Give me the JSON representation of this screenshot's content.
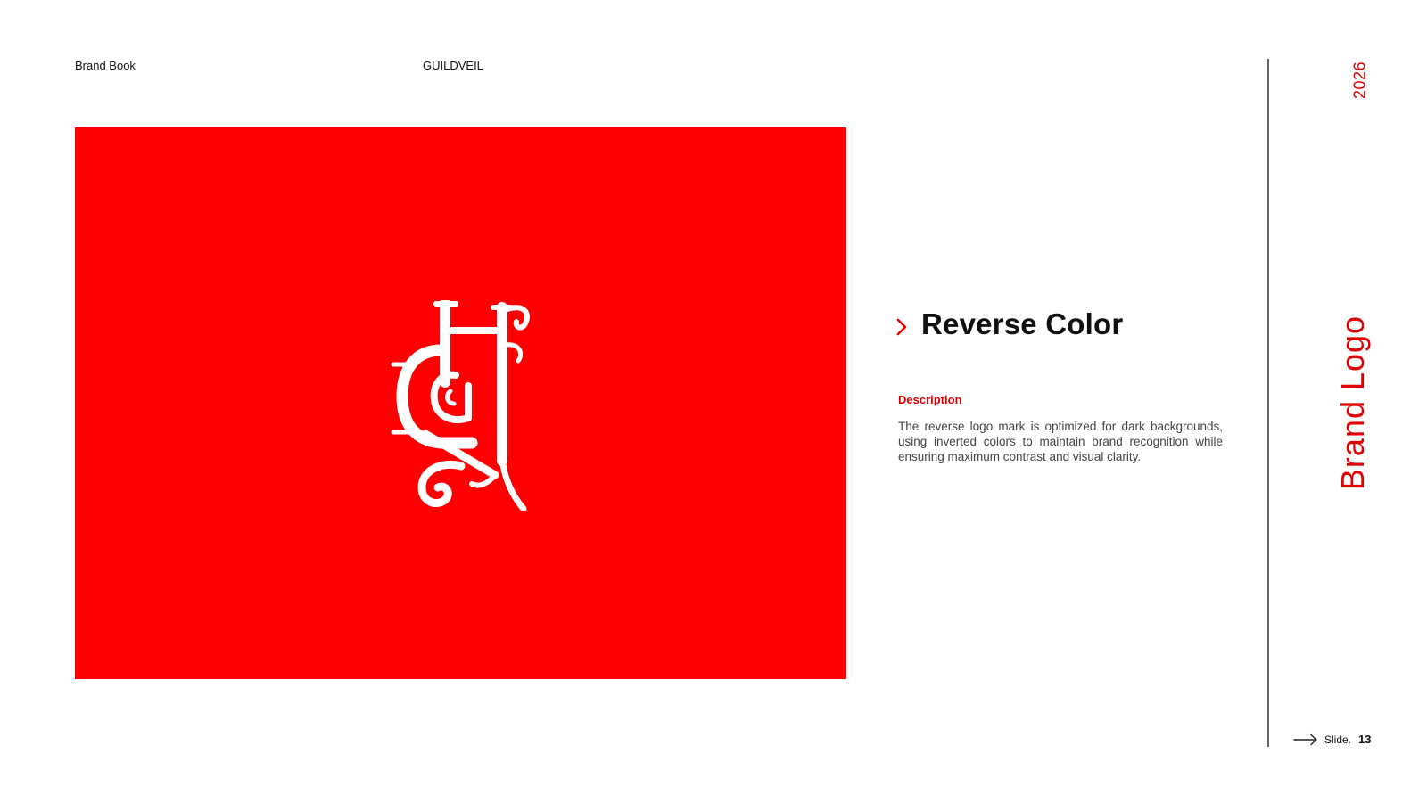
{
  "header": {
    "left_label": "Brand Book",
    "brand_name": "GUILDVEIL"
  },
  "logo": {
    "panel_color": "#fe0000",
    "mark_color": "#ffffff",
    "icon": "gh-monogram-icon"
  },
  "section": {
    "title": "Reverse Color",
    "description_label": "Description",
    "description_text": "The reverse logo mark is optimized for dark backgrounds, using inverted colors to maintain brand recognition while ensuring maximum contrast and visual clarity."
  },
  "sidebar": {
    "year": "2026",
    "title": "Brand Logo"
  },
  "footer": {
    "slide_label": "Slide.",
    "slide_number": "13"
  },
  "colors": {
    "accent": "#e00000",
    "text": "#111111",
    "muted": "#444444"
  }
}
